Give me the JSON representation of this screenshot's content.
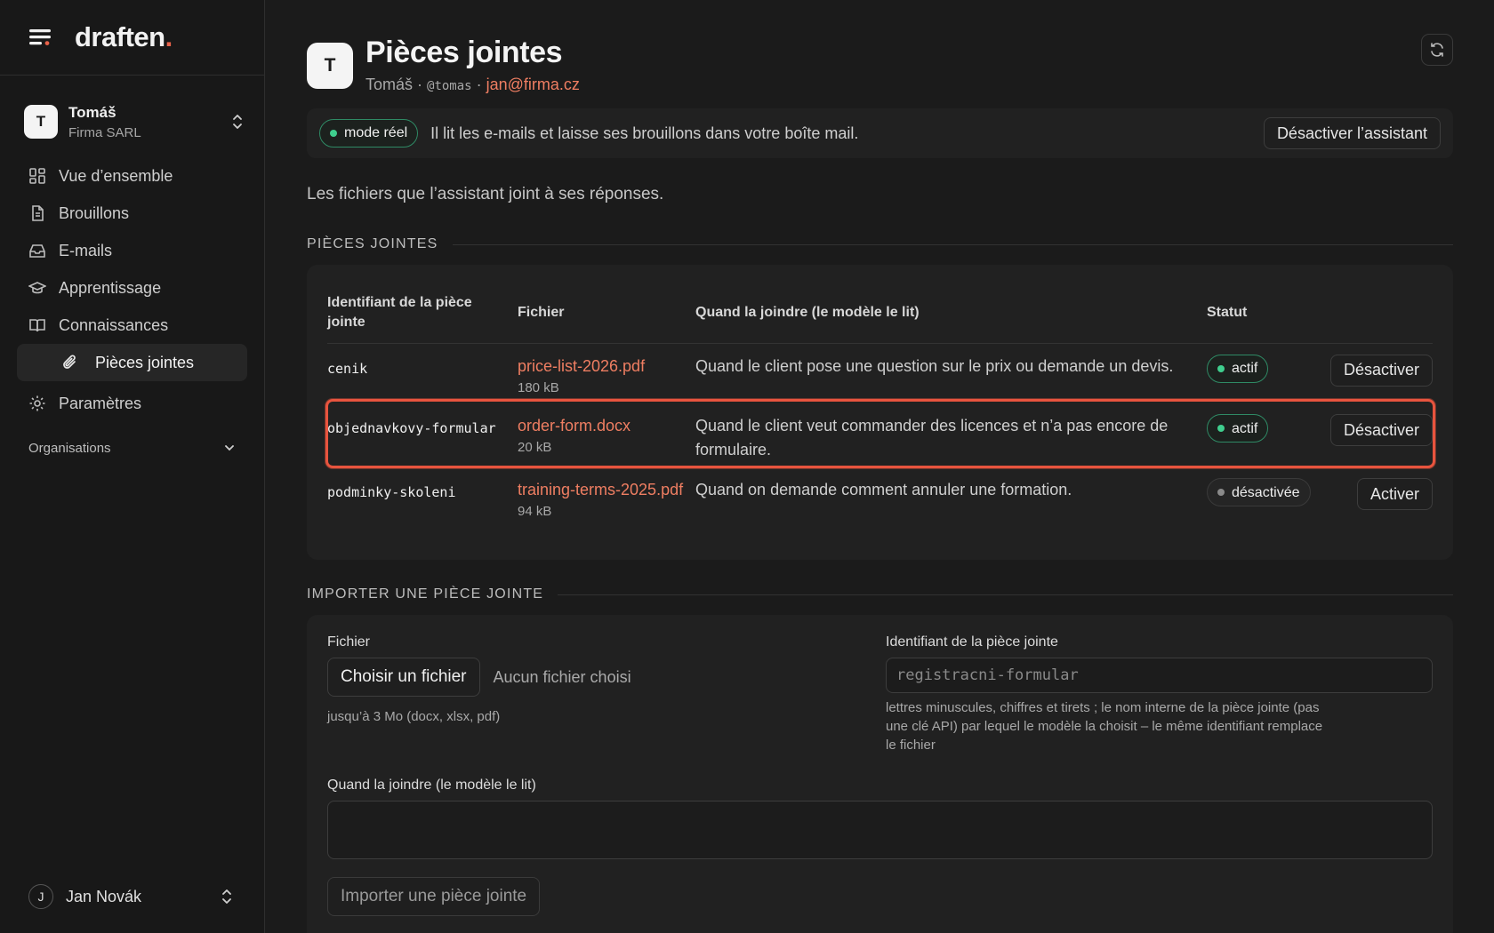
{
  "brand": {
    "name": "draften",
    "dot": "."
  },
  "workspace": {
    "avatar": "T",
    "name": "Tomáš",
    "org": "Firma SARL"
  },
  "nav": {
    "overview": "Vue d’ensemble",
    "drafts": "Brouillons",
    "emails": "E-mails",
    "learning": "Apprentissage",
    "knowledge": "Connaissances",
    "attachments": "Pièces jointes",
    "settings": "Paramètres",
    "organisations": "Organisations"
  },
  "user": {
    "initial": "J",
    "name": "Jan Novák"
  },
  "header": {
    "avatar": "T",
    "title": "Pièces jointes",
    "name": "Tomáš",
    "sep1": " · ",
    "handle": "@tomas",
    "sep2": " · ",
    "email": "jan@firma.cz"
  },
  "mode": {
    "badge": "mode réel",
    "text": "Il lit les e-mails et laisse ses brouillons dans votre boîte mail.",
    "disable_button": "Désactiver l’assistant"
  },
  "intro": "Les fichiers que l’assistant joint à ses réponses.",
  "attachments_section": {
    "title": "PIÈCES JOINTES",
    "columns": [
      "Identifiant de la pièce jointe",
      "Fichier",
      "Quand la joindre (le modèle le lit)",
      "Statut"
    ],
    "rows": [
      {
        "id": "cenik",
        "file": "price-list-2026.pdf",
        "size": "180 kB",
        "when": "Quand le client pose une question sur le prix ou demande un devis.",
        "status": "actif",
        "action": "Désactiver"
      },
      {
        "id": "objednavkovy-formular",
        "file": "order-form.docx",
        "size": "20 kB",
        "when": "Quand le client veut commander des licences et n’a pas encore de formulaire.",
        "status": "actif",
        "action": "Désactiver"
      },
      {
        "id": "podminky-skoleni",
        "file": "training-terms-2025.pdf",
        "size": "94 kB",
        "when": "Quand on demande comment annuler une formation.",
        "status": "désactivée",
        "action": "Activer"
      }
    ]
  },
  "upload_section": {
    "title": "IMPORTER UNE PIÈCE JOINTE",
    "file_label": "Fichier",
    "choose_button": "Choisir un fichier",
    "no_file": "Aucun fichier choisi",
    "file_hint": "jusqu’à 3 Mo (docx, xlsx, pdf)",
    "id_label": "Identifiant de la pièce jointe",
    "id_placeholder": "registracni-formular",
    "id_hint": "lettres minuscules, chiffres et tirets ; le nom interne de la pièce jointe (pas une clé API) par lequel le modèle la choisit – le même identifiant remplace le fichier",
    "when_label": "Quand la joindre (le modèle le lit)",
    "when_value": "",
    "submit": "Importer une pièce jointe"
  },
  "colors": {
    "accent": "#ef7e62",
    "active": "#3fcf8e",
    "highlight": "#e8543e"
  }
}
